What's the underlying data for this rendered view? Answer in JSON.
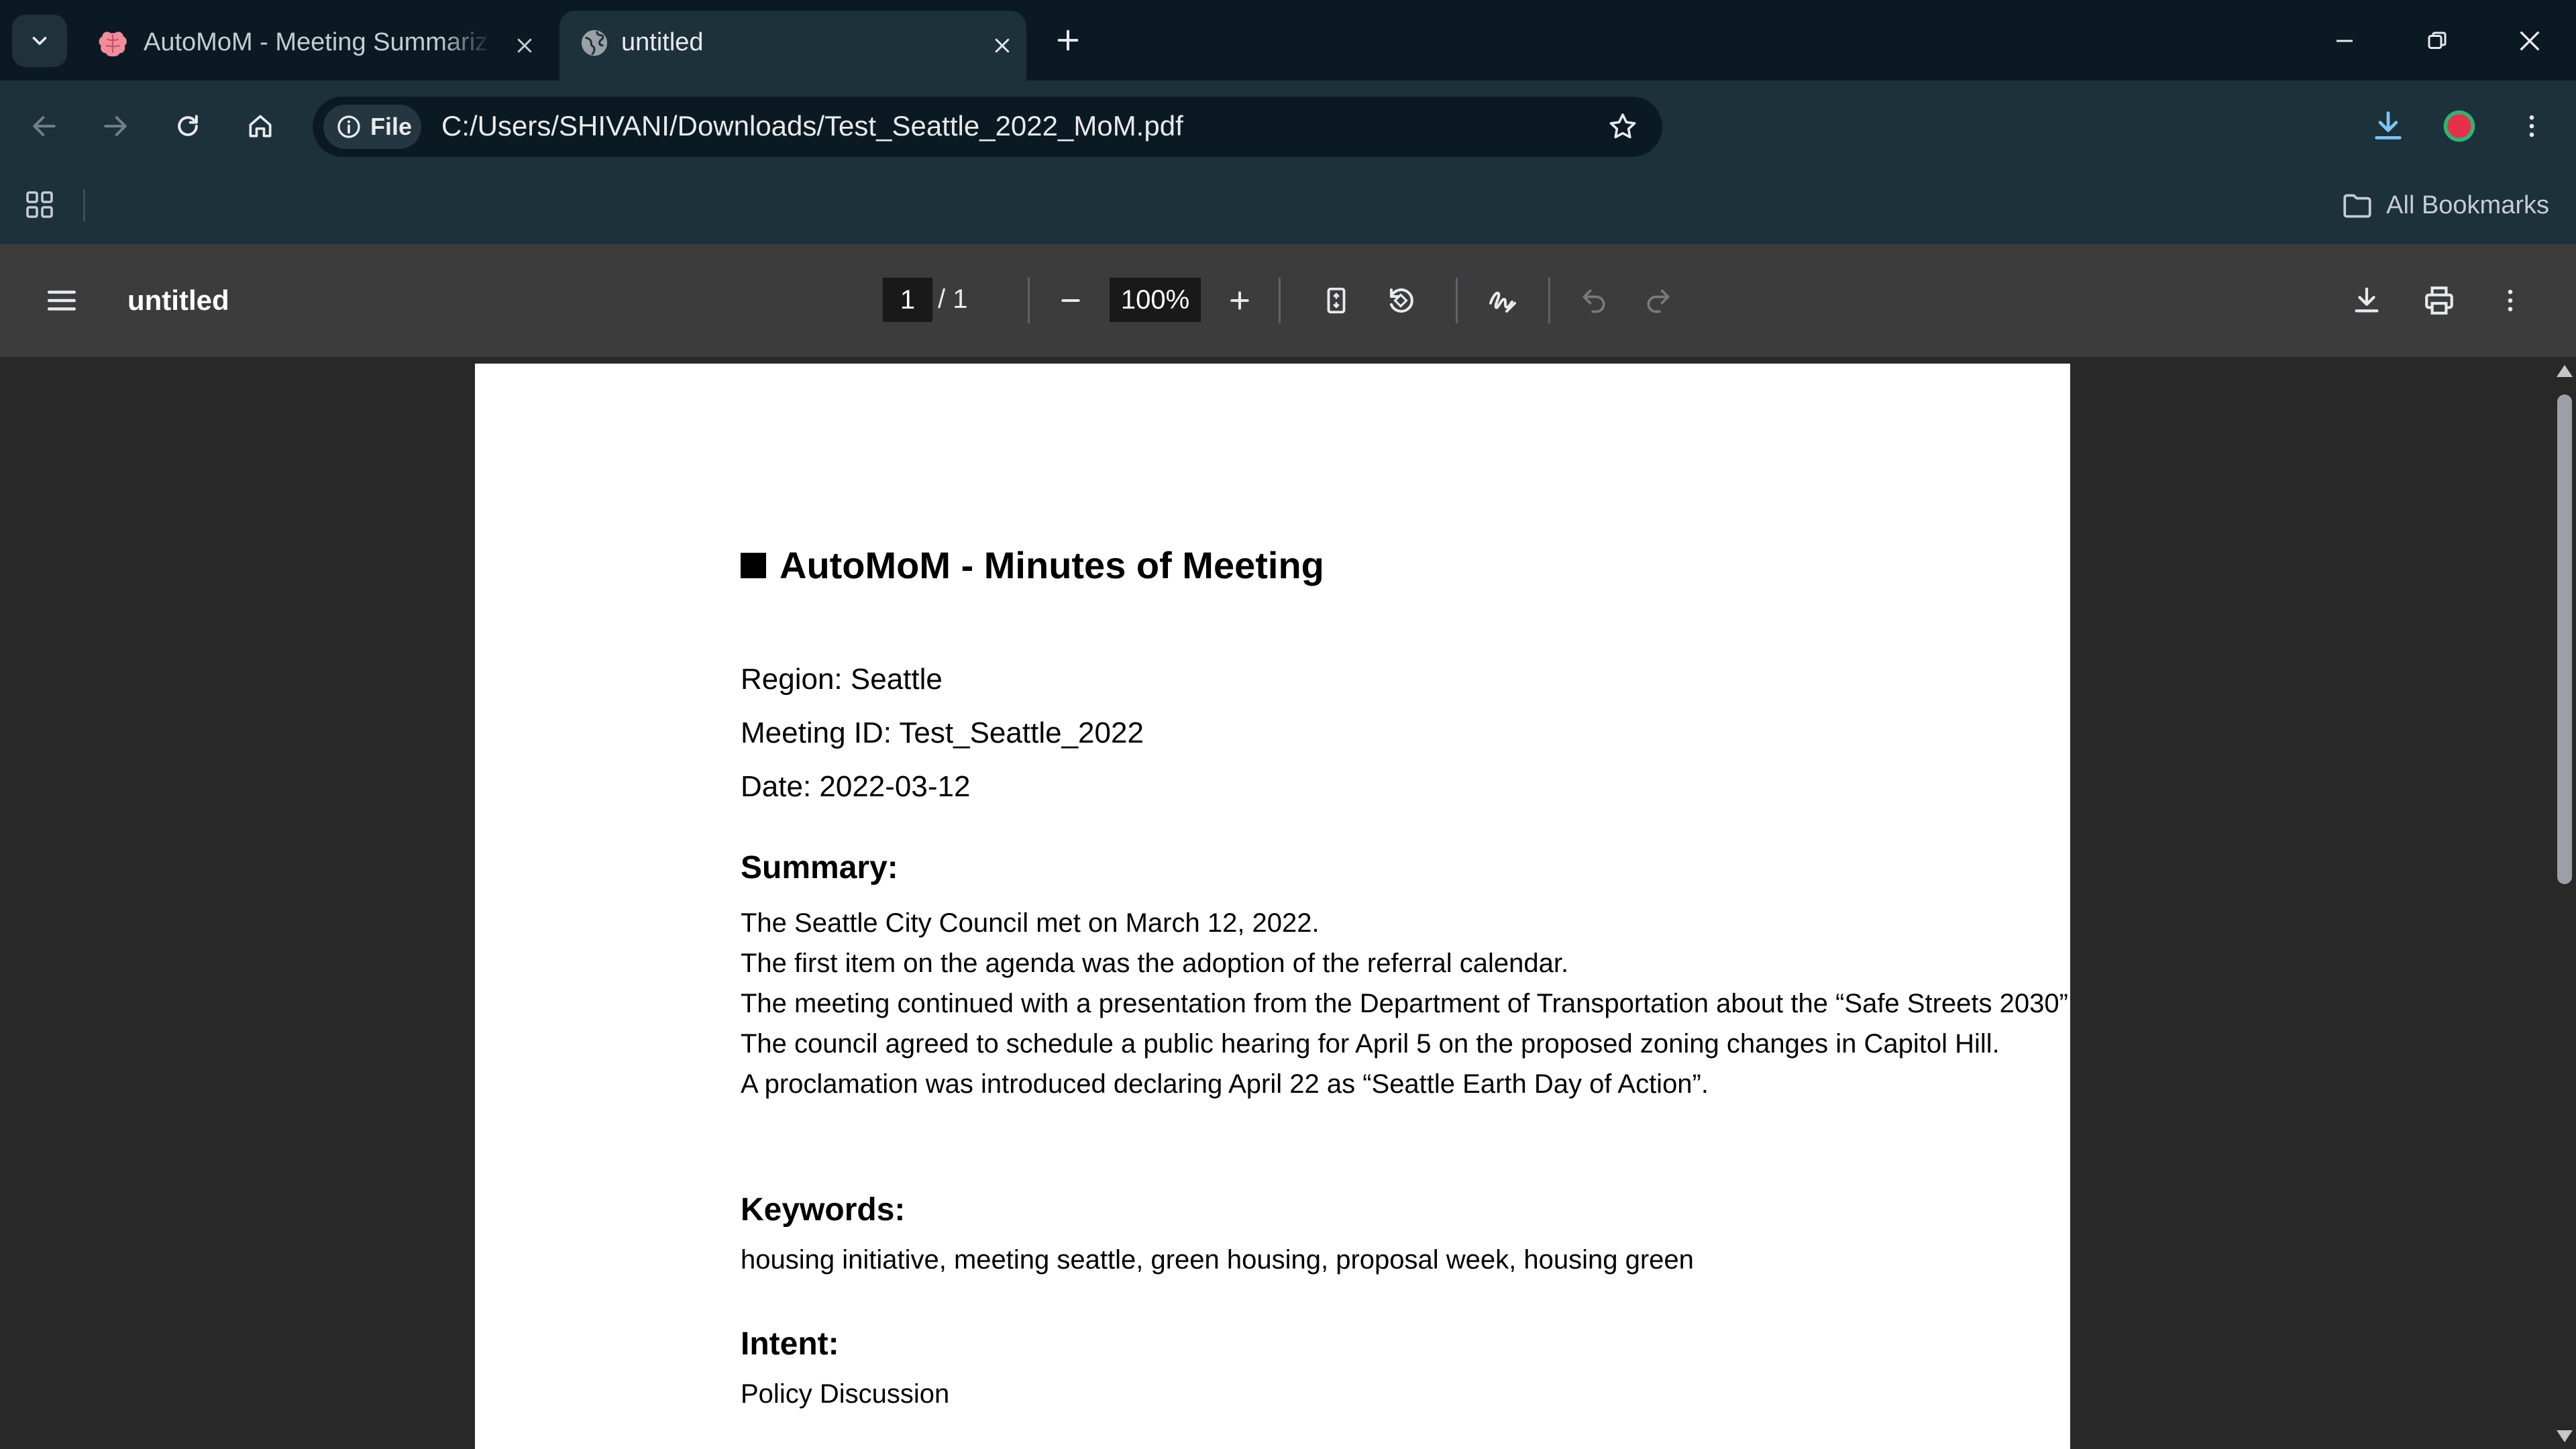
{
  "browser": {
    "tabs": [
      {
        "title": "AutoMoM - Meeting Summariz",
        "icon": "brain-icon",
        "active": false
      },
      {
        "title": "untitled",
        "icon": "globe-icon",
        "active": true
      }
    ],
    "address": {
      "chip_label": "File",
      "url": "C:/Users/SHIVANI/Downloads/Test_Seattle_2022_MoM.pdf"
    },
    "bookmarks": {
      "all_label": "All Bookmarks"
    },
    "profile_color": "#e8304a"
  },
  "pdf": {
    "title": "untitled",
    "page_current": "1",
    "page_total": "/  1",
    "zoom": "100%"
  },
  "document": {
    "title": "AutoMoM - Minutes of Meeting",
    "region": "Region: Seattle",
    "meeting_id": "Meeting ID: Test_Seattle_2022",
    "date": "Date: 2022-03-12",
    "summary_heading": "Summary:",
    "summary_lines": [
      "The Seattle City Council met on March 12, 2022.",
      "The first item on the agenda was the adoption of the referral calendar.",
      "The meeting continued with a presentation from the Department of Transportation about the “Safe Streets 2030”",
      "The council agreed to schedule a public hearing for April 5 on the proposed zoning changes in Capitol Hill.",
      "A proclamation was introduced declaring April 22 as “Seattle Earth Day of Action”."
    ],
    "keywords_heading": "Keywords:",
    "keywords": "housing initiative, meeting seattle, green housing, proposal week, housing green",
    "intent_heading": "Intent:",
    "intent": "Policy Discussion"
  }
}
